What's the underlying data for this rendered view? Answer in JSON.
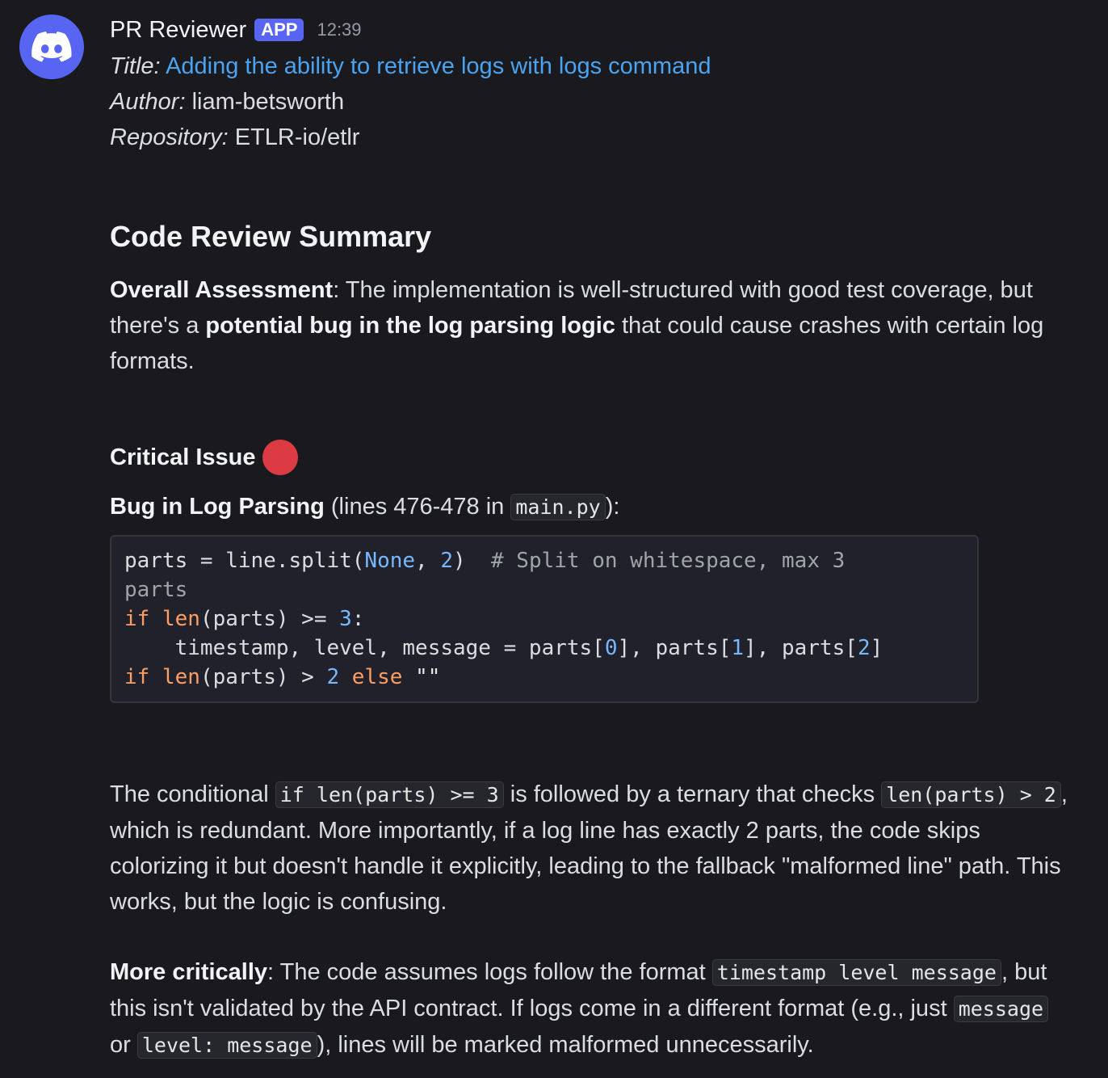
{
  "message": {
    "author": "PR Reviewer",
    "badge": "APP",
    "time": "12:39",
    "meta": {
      "title_label": "Title:",
      "title_value": "Adding the ability to retrieve logs with logs command",
      "author_label": "Author:",
      "author_value": "liam-betsworth",
      "repo_label": "Repository:",
      "repo_value": "ETLR-io/etlr"
    },
    "summary_title": "Code Review Summary",
    "overall": {
      "label": "Overall Assessment",
      "text1": ": The implementation is well-structured with good test coverage, but there's a ",
      "bold": "potential bug in the log parsing logic",
      "text2": " that could cause crashes with certain log formats."
    },
    "critical": {
      "title": "Critical Issue",
      "bug_label": "Bug in Log Parsing",
      "bug_text": " (lines 476-478 in ",
      "bug_file": "main.py",
      "bug_end": "):"
    },
    "code": {
      "l1_a": "parts = line.split(",
      "l1_none": "None",
      "l1_b": ", ",
      "l1_2": "2",
      "l1_c": ")  ",
      "l1_comment": "# Split on whitespace, max 3",
      "l2": "parts",
      "l3_if": "if",
      "l3_len": "len",
      "l3_b": "(parts) >= ",
      "l3_3": "3",
      "l3_c": ":",
      "l4_a": "    timestamp, level, message = parts[",
      "l4_0": "0",
      "l4_b": "], parts[",
      "l4_1": "1",
      "l4_c": "], parts[",
      "l4_2": "2",
      "l4_d": "]",
      "l5_if": "if",
      "l5_len": "len",
      "l5_b": "(parts) > ",
      "l5_2": "2",
      "l5_else": "else",
      "l5_str": "\"\""
    },
    "para2": {
      "t1": "The conditional ",
      "c1": "if len(parts) >= 3",
      "t2": " is followed by a ternary that checks ",
      "c2": "len(parts) > 2",
      "t3": ", which is redundant. More importantly, if a log line has exactly 2 parts, the code skips colorizing it but doesn't handle it explicitly, leading to the fallback \"malformed line\" path. This works, but the logic is confusing."
    },
    "para3": {
      "label": "More critically",
      "t1": ": The code assumes logs follow the format ",
      "c1": "timestamp level message",
      "t2": ", but this isn't validated by the API contract. If logs come in a different format (e.g., just ",
      "c2": "message",
      "t3": " or ",
      "c3": "level: message",
      "t4": "), lines will be marked malformed unnecessarily."
    }
  }
}
